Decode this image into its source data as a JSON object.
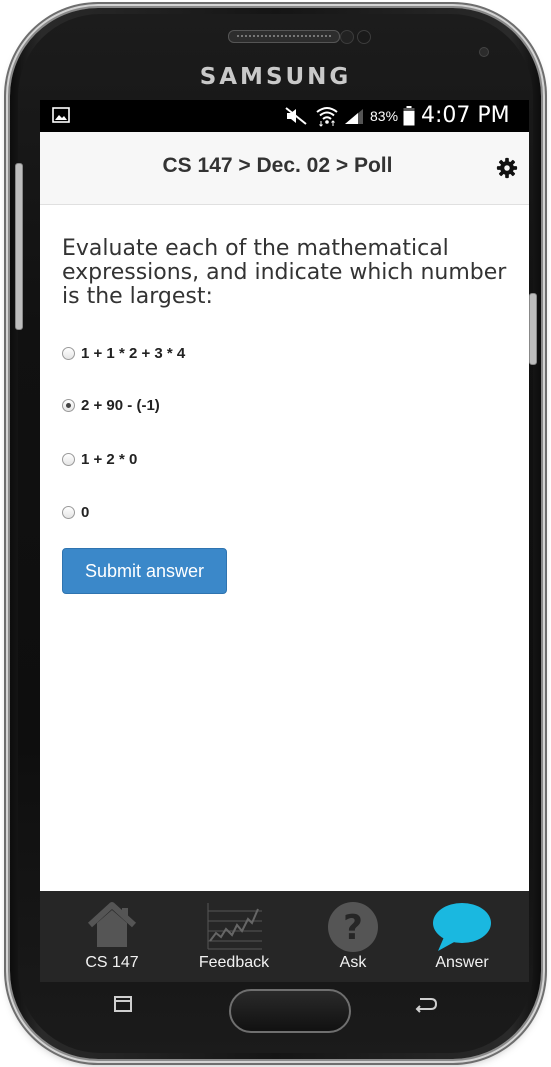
{
  "device": {
    "brand": "SAMSUNG"
  },
  "status_bar": {
    "battery_percent": "83%",
    "time": "4:07 PM",
    "battery_level": 0.83
  },
  "app_bar": {
    "title": "CS 147 > Dec. 02 > Poll",
    "settings_icon": "gear-icon"
  },
  "poll": {
    "question": "Evaluate each of the mathematical expressions, and indicate which number is the largest:",
    "options": [
      {
        "label": "1 + 1 * 2 + 3 * 4",
        "selected": false
      },
      {
        "label": "2 + 90 - (-1)",
        "selected": true
      },
      {
        "label": "1 + 2 * 0",
        "selected": false
      },
      {
        "label": "0",
        "selected": false
      }
    ],
    "submit_label": "Submit answer"
  },
  "tabs": [
    {
      "label": "CS 147",
      "icon": "house-icon",
      "active": false
    },
    {
      "label": "Feedback",
      "icon": "chart-icon",
      "active": false
    },
    {
      "label": "Ask",
      "icon": "question-icon",
      "active": false
    },
    {
      "label": "Answer",
      "icon": "speech-bubble-icon",
      "active": true
    }
  ],
  "colors": {
    "accent": "#3b88c9",
    "tab_active": "#1ab8e0",
    "tab_inactive": "#555555",
    "tabbar_bg": "#262626"
  }
}
